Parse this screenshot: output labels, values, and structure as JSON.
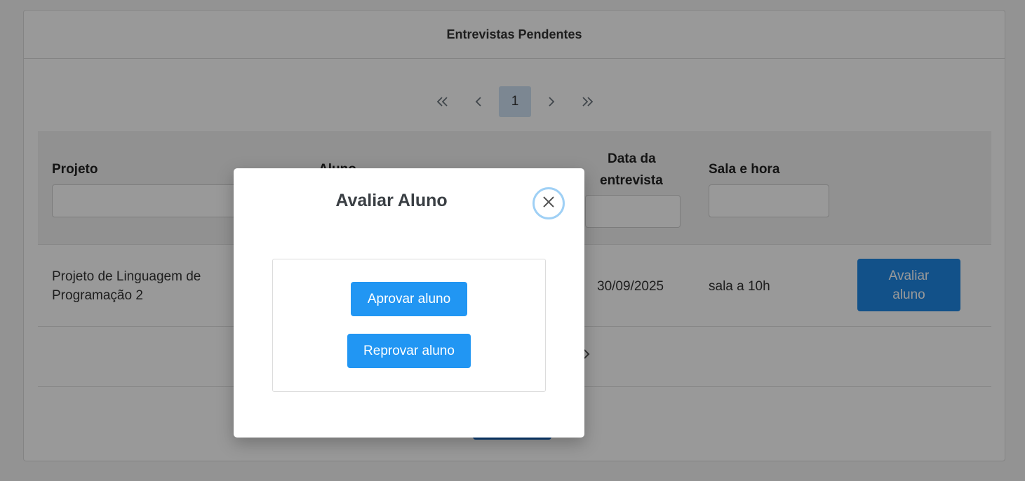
{
  "card": {
    "title": "Entrevistas Pendentes"
  },
  "pagination": {
    "first_icon": "double-chevron-left-icon",
    "prev_icon": "chevron-left-icon",
    "current_page": "1",
    "next_icon": "chevron-right-icon",
    "last_icon": "double-chevron-right-icon"
  },
  "table": {
    "columns": {
      "projeto": "Projeto",
      "aluno": "Aluno",
      "data_line1": "Data da",
      "data_line2": "entrevista",
      "sala": "Sala e hora"
    },
    "rows": [
      {
        "projeto_line1": "Projeto de Linguagem de",
        "projeto_line2": "Programação 2",
        "data": "30/09/2025",
        "sala": "sala a 10h",
        "action_line1": "Avaliar",
        "action_line2": "aluno"
      }
    ]
  },
  "modal": {
    "title": "Avaliar Aluno",
    "close_icon": "close-icon",
    "approve_label": "Aprovar aluno",
    "reject_label": "Reprovar aluno"
  },
  "colors": {
    "primary": "#2196f3",
    "primary_dark": "#1e88e5",
    "close_ring": "#9fd0f5",
    "page_current_bg": "#cfe2f3"
  }
}
